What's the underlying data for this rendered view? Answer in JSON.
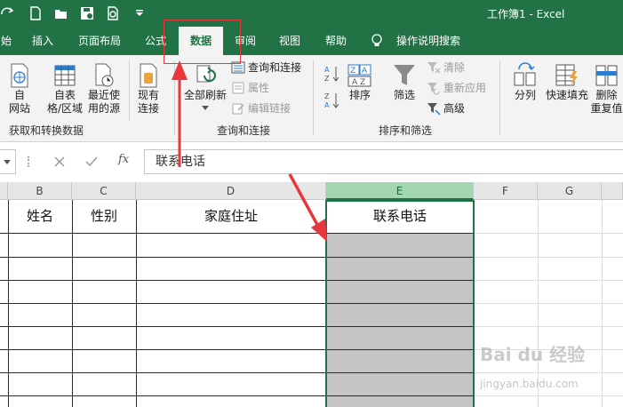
{
  "window": {
    "title": "工作簿1  -  Excel"
  },
  "tabs": [
    {
      "label": "始"
    },
    {
      "label": "插入"
    },
    {
      "label": "页面布局"
    },
    {
      "label": "公式"
    },
    {
      "label": "数据",
      "active": true
    },
    {
      "label": "审阅"
    },
    {
      "label": "视图"
    },
    {
      "label": "帮助"
    },
    {
      "label": "操作说明搜索"
    }
  ],
  "ribbon": {
    "get_transform": {
      "buttons": [
        {
          "label": "自\n网站"
        },
        {
          "label": "自表\n格/区域"
        },
        {
          "label": "最近使\n用的源"
        },
        {
          "label": "现有\n连接"
        }
      ],
      "group_label": "获取和转换数据"
    },
    "queries": {
      "refresh_all": "全部刷新",
      "items": [
        {
          "label": "查询和连接",
          "enabled": true
        },
        {
          "label": "属性",
          "enabled": false
        },
        {
          "label": "编辑链接",
          "enabled": false
        }
      ],
      "group_label": "查询和连接"
    },
    "sort_filter": {
      "sort": "排序",
      "filter": "筛选",
      "items": [
        {
          "label": "清除",
          "enabled": false
        },
        {
          "label": "重新应用",
          "enabled": false
        },
        {
          "label": "高级",
          "enabled": true
        }
      ],
      "group_label": "排序和筛选"
    },
    "data_tools": {
      "buttons": [
        {
          "label": "分列"
        },
        {
          "label": "快速填充"
        },
        {
          "label": "删除\n重复值"
        }
      ]
    }
  },
  "formula_bar": {
    "fx": "fx",
    "value": "联系电话"
  },
  "sheet": {
    "columns": [
      "B",
      "C",
      "D",
      "E",
      "F",
      "G"
    ],
    "selected_column": "E",
    "header_row": [
      "姓名",
      "性别",
      "家庭住址",
      "联系电话"
    ]
  },
  "watermark": {
    "text": "Bai du 经验",
    "url": "jingyan.baidu.com"
  },
  "colors": {
    "excel_green": "#217346",
    "annotation_red": "#e8383d"
  }
}
